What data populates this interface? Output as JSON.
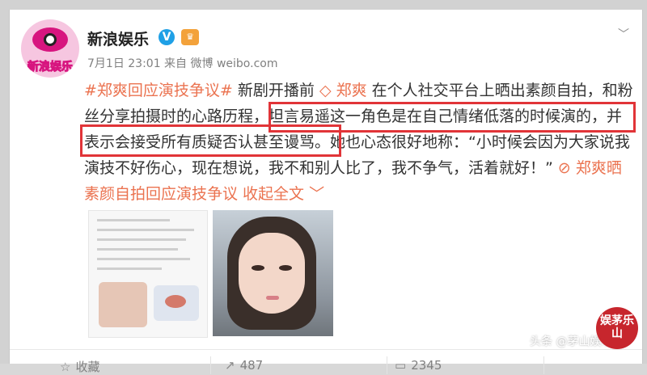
{
  "post": {
    "author": "新浪娱乐",
    "verified_mark": "V",
    "crown_icon": "crown-icon",
    "avatar_text": "新浪娱乐",
    "meta": "7月1日 23:01 来自 微博 weibo.com",
    "chevron": "﹀"
  },
  "body": {
    "line1": {
      "hashtag": "#郑爽回应演技争议#",
      "t1": " 新剧开播前 ",
      "mention_icon": "◇",
      "mention": " 郑爽",
      "t2": " 在个人社交平台上晒出素颜自拍，和粉"
    },
    "line2": "丝分享拍摄时的心路历程，坦言易遥这一角色是在自己情绪低落的时候演的，并",
    "line3": "表示会接受所有质疑否认甚至谩骂。她也心态很好地称：“小时候会因为大家说我",
    "line4": {
      "t1": "演技不好伤心，现在想说，我不和别人比了，我不争气，活着就好！”",
      "link": " ⊘ 郑爽晒"
    },
    "line5": {
      "link": "素颜自拍回应演技争议",
      "collapse": " 收起全文 ",
      "chevron": "﹀"
    }
  },
  "actions": {
    "favorite": {
      "icon": "☆",
      "label": "收藏"
    },
    "repost": {
      "icon": "↗",
      "label": "487"
    },
    "comment": {
      "icon": "▭",
      "label": "2345"
    }
  },
  "watermark": "头条 @茅山娱乐",
  "stamp_text": "娱茅乐山",
  "colors": {
    "accent": "#eb7350",
    "highlight_box": "#e13438",
    "link_blue": "#3a73c8",
    "verified": "#1fa0e6"
  }
}
